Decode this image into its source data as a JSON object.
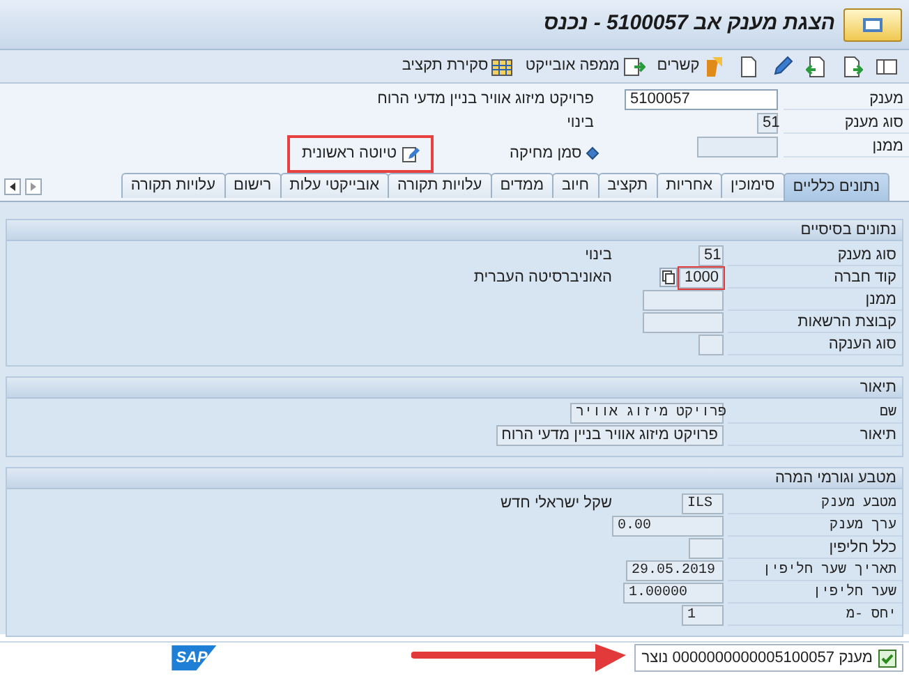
{
  "window": {
    "title": "הצגת מענק אב 5100057 - נכנס"
  },
  "toolbar": {
    "buttons": [
      {
        "label": "קשרים"
      },
      {
        "label": "ממפה אובייקט"
      },
      {
        "label": "סקירת תקציב"
      }
    ]
  },
  "header": {
    "fields": [
      {
        "label": "מענק",
        "value": "5100057",
        "note": "פרויקט מיזוג אוויר בניין מדעי הרוח",
        "editable": true
      },
      {
        "label": "סוג מענק",
        "value": "51",
        "note": "בינוי",
        "editable": false
      },
      {
        "label": "ממנן",
        "editable": false
      }
    ],
    "deletion_flag": {
      "label": "סמן מחיקה"
    },
    "status": {
      "label": "טיוטה ראשונית"
    }
  },
  "tabs": [
    {
      "label": "נתונים כלליים",
      "selected": true
    },
    {
      "label": "סימוכין",
      "selected": false
    },
    {
      "label": "אחריות",
      "selected": false
    },
    {
      "label": "תקציב",
      "selected": false
    },
    {
      "label": "חיוב",
      "selected": false
    },
    {
      "label": "ממדים",
      "selected": false
    },
    {
      "label": "עלויות תקורה",
      "selected": false
    },
    {
      "label": "אובייקטי עלות",
      "selected": false
    },
    {
      "label": "רישום",
      "selected": false
    },
    {
      "label": "עלויות תקורה",
      "selected": false
    }
  ],
  "sections": [
    {
      "title": "נתונים בסיסיים",
      "rows": [
        {
          "kind": "field",
          "label": "סוג מענק",
          "value": "51",
          "note": "בינוי",
          "focused": false
        },
        {
          "kind": "field",
          "label": "קוד חברה",
          "value": "1000",
          "note": "האוניברסיטה העברית",
          "focused": true
        },
        {
          "kind": "field",
          "label": "ממנן",
          "focused": false
        },
        {
          "kind": "field",
          "label": "קבוצת הרשאות",
          "focused": false
        },
        {
          "kind": "field",
          "label": "סוג הענקה",
          "focused": false
        }
      ]
    },
    {
      "title": "תיאור",
      "rows": [
        {
          "kind": "technical",
          "label": "שם",
          "value": "פרויקט מיזוג אוויר"
        },
        {
          "kind": "field",
          "label": "תיאור",
          "value": "פרויקט מיזוג אוויר בניין מדעי הרוח"
        }
      ]
    },
    {
      "title": "מטבע וגורמי המרה",
      "rows": [
        {
          "kind": "technical",
          "label": "מטבע מענק",
          "value": "ILS",
          "note": "שקל ישראלי חדש"
        },
        {
          "kind": "technical",
          "label": "ערך מענק",
          "value": "0.00"
        },
        {
          "kind": "field",
          "label": "כלל חליפין"
        },
        {
          "kind": "technical",
          "label": "תאריך שער חליפין",
          "value": "29.05.2019"
        },
        {
          "kind": "technical",
          "label": "שער חליפין",
          "value": "1.00000"
        },
        {
          "kind": "technical",
          "label": "יחס -מ",
          "value": "1"
        }
      ]
    }
  ],
  "status_bar": {
    "logo": "SAP",
    "success": true,
    "text": "מענק 0000000000005100057 נוצר"
  }
}
